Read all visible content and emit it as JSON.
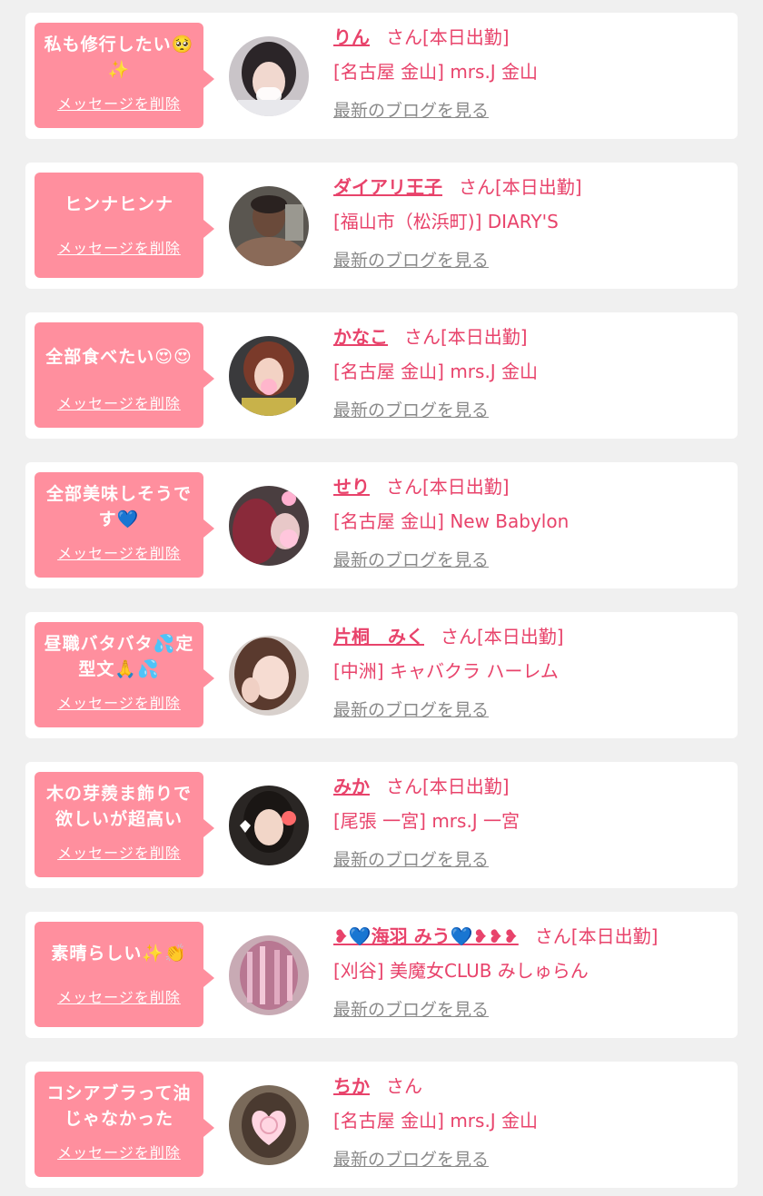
{
  "colors": {
    "background": "#f0f0f0",
    "card": "#ffffff",
    "bubble": "#ff8f9e",
    "accent": "#e8436b",
    "muted": "#8a8a8a"
  },
  "delete_label": "メッセージを削除",
  "blog_label": "最新のブログを見る",
  "items": [
    {
      "message": "私も修行したい🥺✨",
      "name": "りん",
      "status": "さん[本日出勤]",
      "shop": "[名古屋 金山] mrs.J 金山",
      "avatar_icon": "girl-avatar-icon"
    },
    {
      "message": "ヒンナヒンナ",
      "name": "ダイアリ王子",
      "status": "さん[本日出勤]",
      "shop": "[福山市（松浜町)] DIARY'S",
      "avatar_icon": "warrior-avatar-icon"
    },
    {
      "message": "全部食べたい😍😍",
      "name": "かなこ",
      "status": "さん[本日出勤]",
      "shop": "[名古屋 金山] mrs.J 金山",
      "avatar_icon": "girl-avatar-icon"
    },
    {
      "message": "全部美味しそうです💙",
      "name": "せり",
      "status": "さん[本日出勤]",
      "shop": "[名古屋 金山] New Babylon",
      "avatar_icon": "girl-avatar-icon"
    },
    {
      "message": "昼職バタバタ💦定型文🙏💦",
      "name": "片桐　みく",
      "status": "さん[本日出勤]",
      "shop": "[中洲] キャバクラ ハーレム",
      "avatar_icon": "girl-avatar-icon"
    },
    {
      "message": "木の芽羨ま飾りで欲しいが超高い",
      "name": "みか",
      "status": "さん[本日出勤]",
      "shop": "[尾張 一宮] mrs.J 一宮",
      "avatar_icon": "girl-avatar-icon"
    },
    {
      "message": "素晴らしい✨👏",
      "name": "❥💙海羽 みう💙❥❥❥",
      "status": "さん[本日出勤]",
      "shop": "[刈谷] 美魔女CLUB みしゅらん",
      "avatar_icon": "girl-avatar-icon"
    },
    {
      "message": "コシアブラって油じゃなかった",
      "name": "ちか",
      "status": "さん",
      "shop": "[名古屋 金山] mrs.J 金山",
      "avatar_icon": "girl-avatar-icon"
    }
  ]
}
